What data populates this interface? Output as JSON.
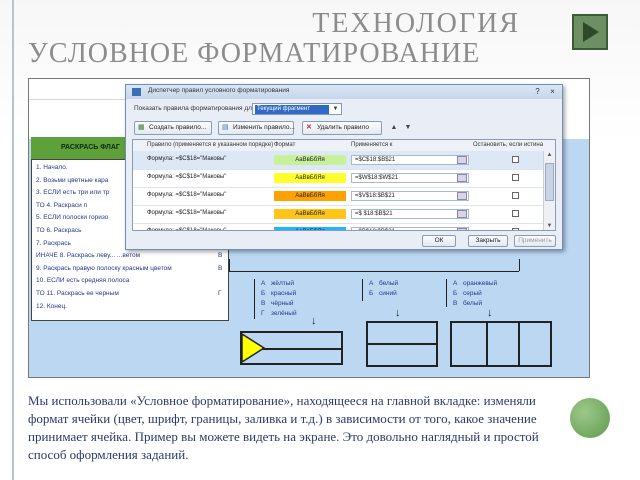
{
  "slide": {
    "title_line1": "ТЕХНОЛОГИЯ",
    "title_line2": "УСЛОВНОЕ ФОРМАТИРОВАНИЕ",
    "nav_icon": "play-triangle-icon",
    "caption": "Мы использовали «Условное форматирование», находящееся на главной вкладке: изменяли формат ячейки (цвет, шрифт, границы, заливка и т.д.) в зависимости от того, какое значение принимает ячейка. Пример вы можете видеть на экране. Это довольно наглядный и простой способ оформления заданий."
  },
  "sheet": {
    "green_header": "РАСКРАСЬ ФЛАГ",
    "steps": [
      {
        "text": "1.  Начало.",
        "right": ""
      },
      {
        "text": "2.  Возьми цветные кара",
        "right": ""
      },
      {
        "text": "3.  ЕСЛИ есть три или тр",
        "right": ""
      },
      {
        "text": "     ТО    4.  Раскраси п",
        "right": ""
      },
      {
        "text": "5.  ЕСЛИ полоски горизо",
        "right": ""
      },
      {
        "text": "     ТО     6.  Раскрась",
        "right": ""
      },
      {
        "text": "               7.  Раскрась",
        "right": ""
      },
      {
        "text": "     ИНАЧЕ  8.  Раскрась леву... ...ветом",
        "right": "В"
      },
      {
        "text": "               9.  Раскрась правую полоску красным цветом",
        "right": "В"
      },
      {
        "text": "10. ЕСЛИ есть средняя полоса",
        "right": ""
      },
      {
        "text": "     ТО     11.  Раскрась ее черным",
        "right": "Г"
      },
      {
        "text": "12. Конец.",
        "right": ""
      }
    ],
    "columns": [
      {
        "rows": [
          [
            "А",
            "жёлтый"
          ],
          [
            "Б",
            "красный"
          ],
          [
            "В",
            "чёрный"
          ],
          [
            "Г",
            "зелёный"
          ]
        ]
      },
      {
        "rows": [
          [
            "А",
            "белый"
          ],
          [
            "Б",
            "синий"
          ]
        ]
      },
      {
        "rows": [
          [
            "А",
            "оранжевый"
          ],
          [
            "Б",
            "серый"
          ],
          [
            "В",
            "белый"
          ]
        ]
      }
    ],
    "fill_colors": {
      "highlight": "#ffff00",
      "border": "#222222",
      "sheet_bg": "#bcd7f2",
      "header_green": "#5ea03a"
    }
  },
  "dialog": {
    "title": "Диспетчер правил условного форматирования",
    "close_label": "×",
    "min_label": "?",
    "show_label": "Показать правила форматирования для:",
    "show_value": "Текущий фрагмент",
    "buttons": {
      "new": "Создать правило...",
      "edit": "Изменить правило...",
      "delete": "Удалить правило"
    },
    "headers": {
      "rule": "Правило (применяется в указанном порядке)",
      "format": "Формат",
      "applies": "Применяется к",
      "stop": "Остановить, если истина"
    },
    "rules": [
      {
        "rule": "Формула: =$C$18=\"Маковы\"",
        "format": "АаВвБбЯя",
        "color": "#c8ef9a",
        "applies": "=$C$18:$B$21"
      },
      {
        "rule": "Формула: =$C$18=\"Маковы\"",
        "format": "АаВвБбЯя",
        "color": "#ffff2e",
        "applies": "=$W$18:$W$21"
      },
      {
        "rule": "Формула: =$C$18=\"Маковы\"",
        "format": "АаВвБбЯя",
        "color": "#ffa200",
        "applies": "=$V$18:$B$21"
      },
      {
        "rule": "Формула: =$C$18=\"Маковы\"",
        "format": "АаВвБбЯя",
        "color": "#ffc51a",
        "applies": "=$ $18:$B$21"
      },
      {
        "rule": "Формула: =$C$18=\"Маковы\"",
        "format": "АаВвБбЯя",
        "color": "#1fb4ff",
        "applies": "=$B$18:$B$21"
      }
    ],
    "footer": {
      "ok": "ОК",
      "close": "Закрыть",
      "apply": "Применить"
    }
  }
}
